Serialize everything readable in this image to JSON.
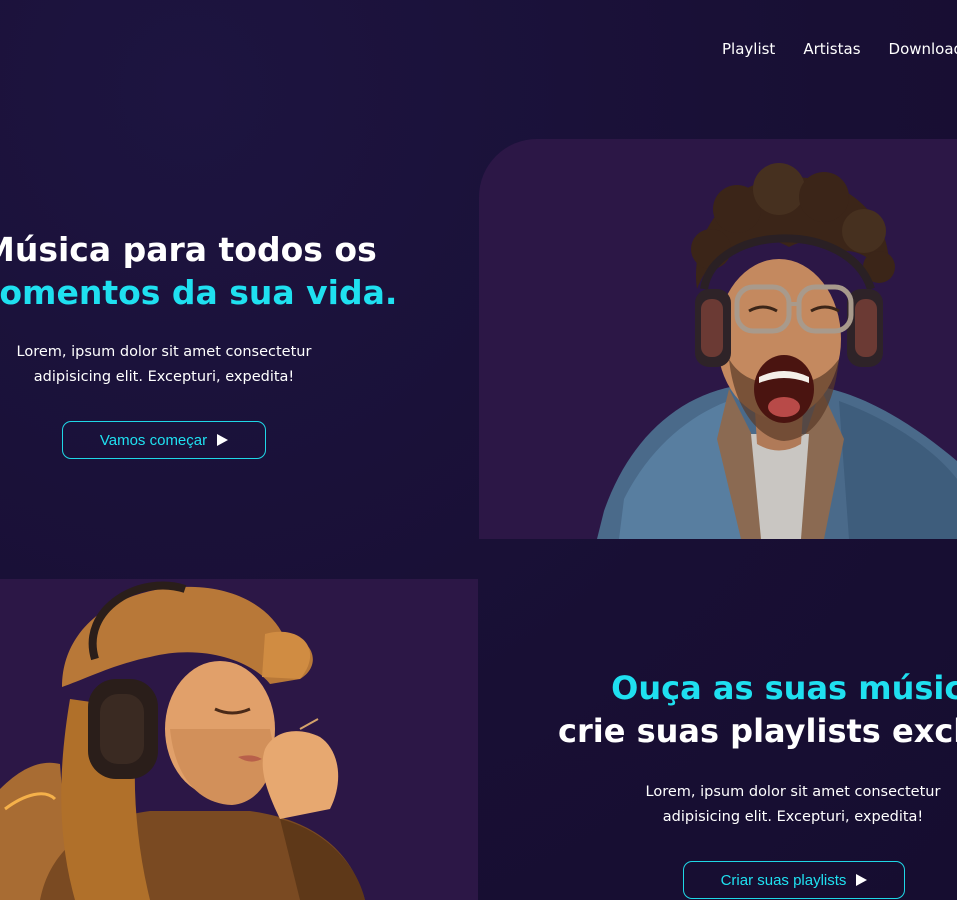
{
  "nav": {
    "items": [
      {
        "label": "Playlist"
      },
      {
        "label": "Artistas"
      },
      {
        "label": "Download"
      }
    ]
  },
  "hero1": {
    "title_line1": "Música para todos os",
    "title_line2": "momentos da sua vida.",
    "description": "Lorem, ipsum dolor sit amet consectetur adipisicing elit. Excepturi, expedita!",
    "button_label": "Vamos começar",
    "button_icon": "play-icon"
  },
  "hero2": {
    "title_line1": "Ouça as suas músicas e",
    "title_line2": "crie suas playlists exclusivas",
    "description": "Lorem, ipsum dolor sit amet consectetur adipisicing elit. Excepturi, expedita!",
    "button_label": "Criar suas playlists",
    "button_icon": "play-icon"
  },
  "colors": {
    "background": "#1a1138",
    "accent": "#1fe0f0",
    "image_panel": "#2c1746",
    "text": "#ffffff"
  }
}
